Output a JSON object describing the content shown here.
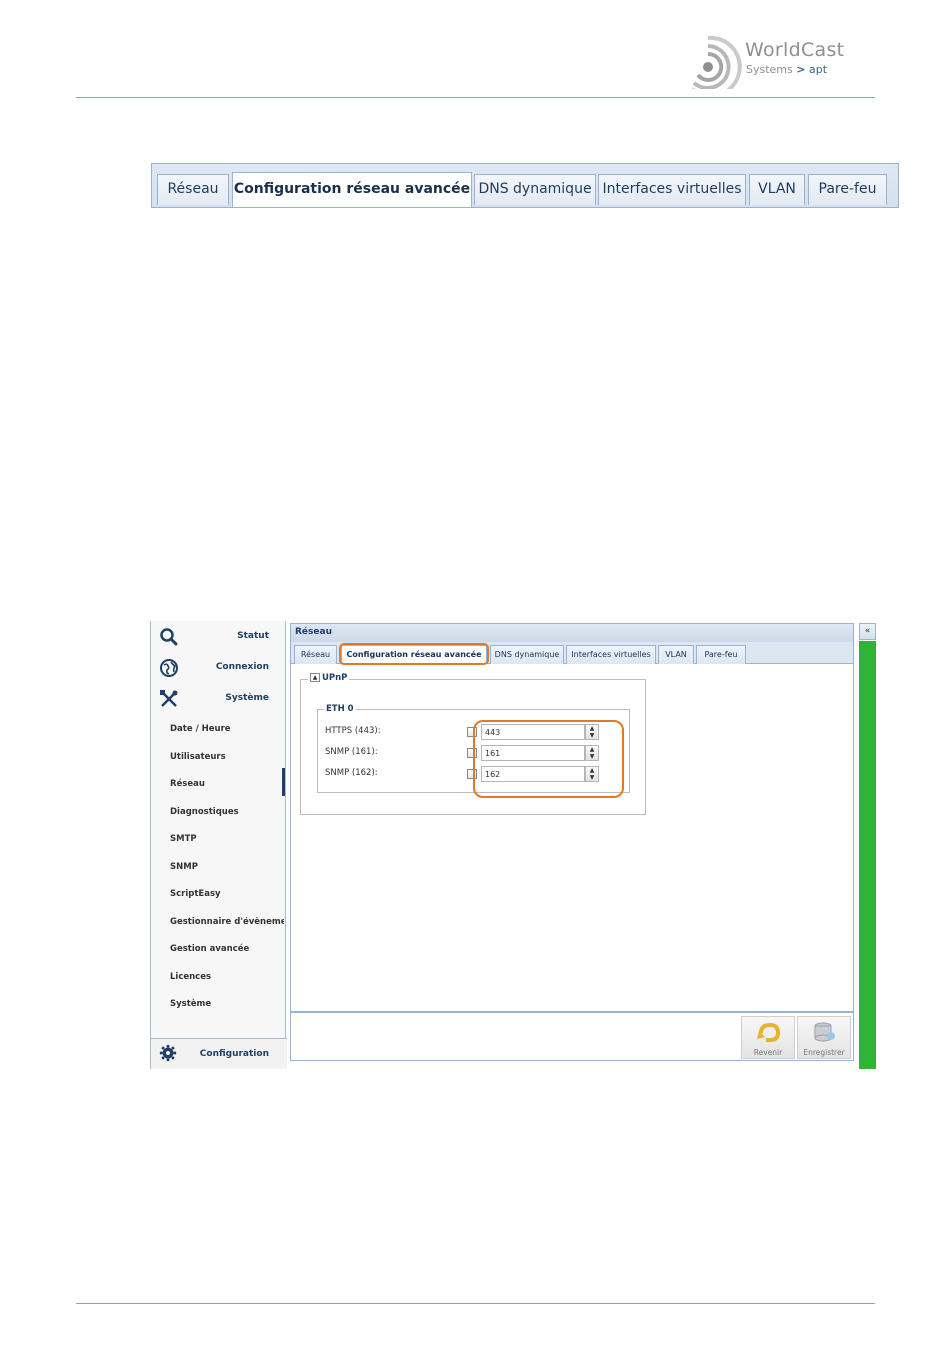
{
  "logo": {
    "word": "WorldCast",
    "sub_left": "Systems",
    "chev": ">",
    "sub_right": "apt"
  },
  "bigtabs": [
    "Réseau",
    "Configuration réseau avancée",
    "DNS dynamique",
    "Interfaces virtuelles",
    "VLAN",
    "Pare-feu"
  ],
  "sidebar": {
    "sections": [
      "Statut",
      "Connexion",
      "Système"
    ],
    "items": [
      "Date / Heure",
      "Utilisateurs",
      "Réseau",
      "Diagnostiques",
      "SMTP",
      "SNMP",
      "ScriptEasy",
      "Gestionnaire d'évènement",
      "Gestion avancée",
      "Licences",
      "Système"
    ],
    "active_item": "Réseau",
    "bottom": "Configuration"
  },
  "panel": {
    "title": "Réseau",
    "tabs": [
      "Réseau",
      "Configuration réseau avancée",
      "DNS dynamique",
      "Interfaces virtuelles",
      "VLAN",
      "Pare-feu"
    ],
    "active_tab": "Configuration réseau avancée",
    "upnp_legend": "UPnP",
    "eth_legend": "ETH 0",
    "fields": [
      {
        "label": "HTTPS (443):",
        "checked": false,
        "value": "443"
      },
      {
        "label": "SNMP (161):",
        "checked": false,
        "value": "161"
      },
      {
        "label": "SNMP (162):",
        "checked": false,
        "value": "162"
      }
    ]
  },
  "buttons": {
    "revert": "Revenir",
    "save": "Enregistrer"
  },
  "collapse_right": "«",
  "colors": {
    "accent_ring": "#e07b24",
    "status_green": "#2fb536",
    "nav_blue": "#1f3f66"
  }
}
